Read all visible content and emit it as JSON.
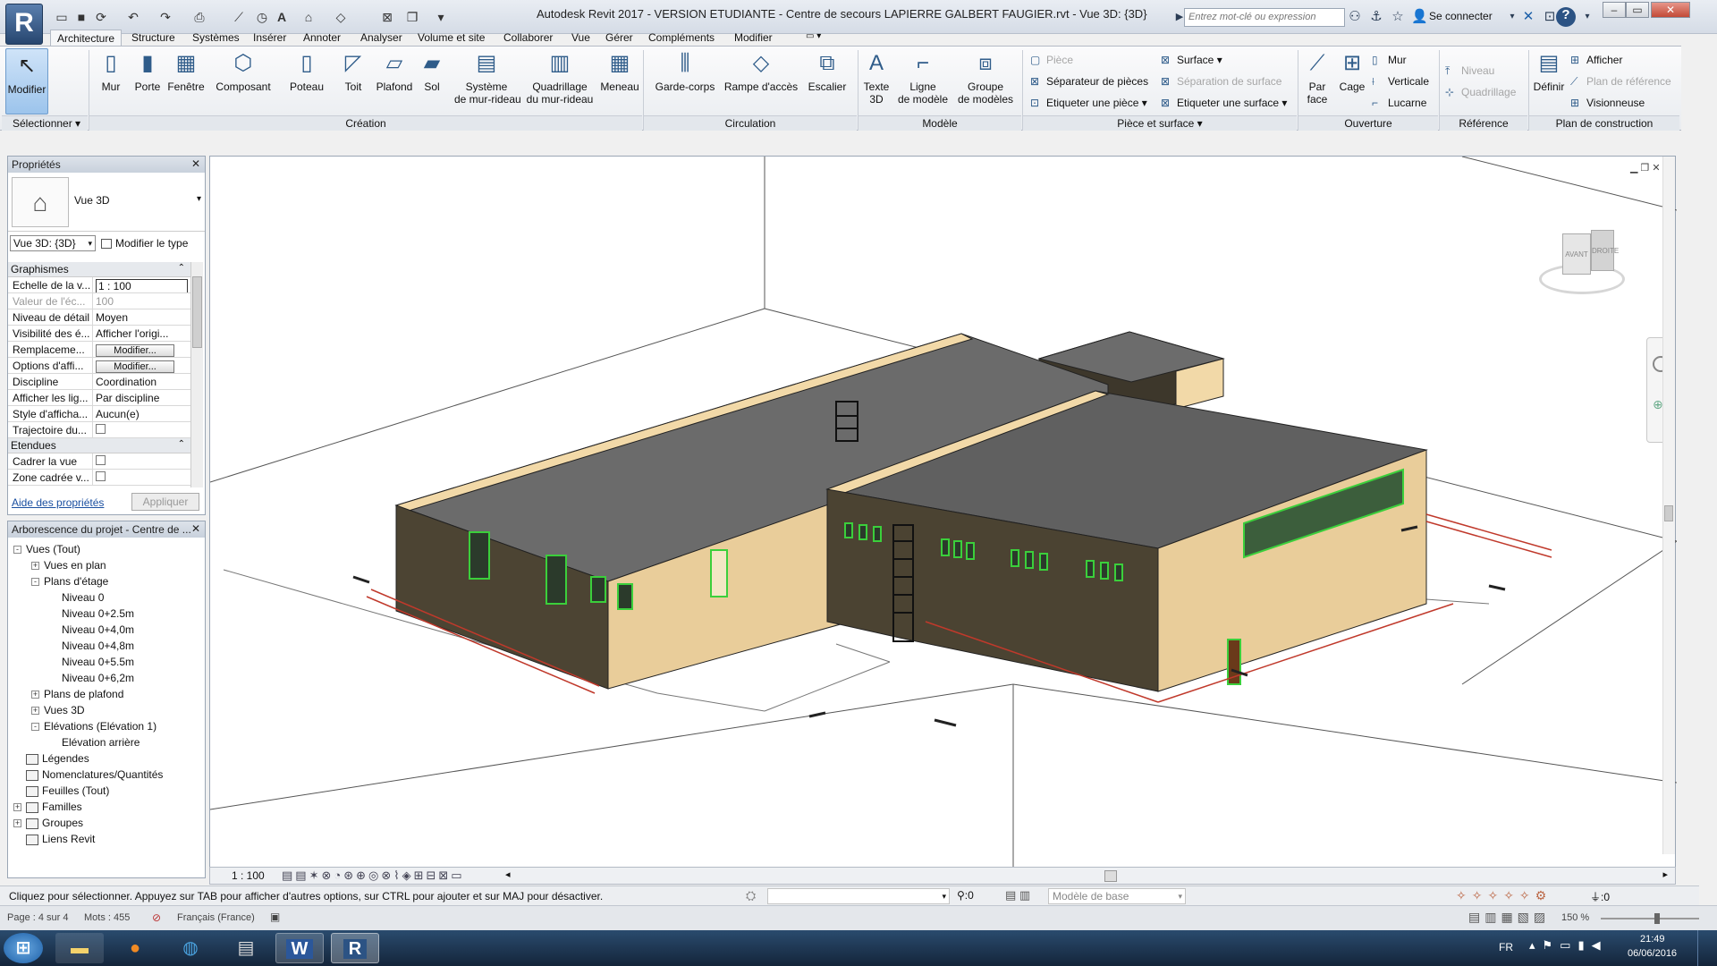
{
  "app": {
    "title": "Autodesk Revit 2017 - VERSION ETUDIANTE -",
    "file_title": "Centre de secours LAPIERRE GALBERT FAUGIER.rvt - Vue 3D: {3D}",
    "search_placeholder": "Entrez mot-clé ou expression",
    "sign_in": "Se connecter",
    "logo_letter": "R"
  },
  "tabs": [
    "Architecture",
    "Structure",
    "Systèmes",
    "Insérer",
    "Annoter",
    "Analyser",
    "Volume et site",
    "Collaborer",
    "Vue",
    "Gérer",
    "Compléments",
    "Modifier"
  ],
  "ribbon": {
    "select": {
      "modify": "Modifier",
      "label": "Sélectionner"
    },
    "creation": {
      "label": "Création",
      "buttons": [
        "Mur",
        "Porte",
        "Fenêtre",
        "Composant",
        "Poteau",
        "Toit",
        "Plafond",
        "Sol",
        "Système\nde mur-rideau",
        "Quadrillage\ndu mur-rideau",
        "Meneau"
      ]
    },
    "circulation": {
      "label": "Circulation",
      "buttons": [
        "Garde-corps",
        "Rampe d'accès",
        "Escalier"
      ]
    },
    "modele": {
      "label": "Modèle",
      "buttons": [
        "Texte\n3D",
        "Ligne\nde modèle",
        "Groupe\nde modèles"
      ]
    },
    "piece": {
      "label": "Pièce et surface",
      "items": [
        "Pièce",
        "Séparateur de pièces",
        "Etiqueter une pièce",
        "Surface",
        "Séparation de surface",
        "Etiqueter une surface"
      ]
    },
    "ouverture": {
      "label": "Ouverture",
      "par_face": "Par\nface",
      "cage": "Cage",
      "items": [
        "Mur",
        "Verticale",
        "Lucarne"
      ]
    },
    "reference": {
      "label": "Référence",
      "items": [
        "Niveau",
        "Quadrillage"
      ]
    },
    "plan": {
      "label": "Plan de construction",
      "definir": "Définir",
      "items": [
        "Afficher",
        "Plan de référence",
        "Visionneuse"
      ]
    }
  },
  "properties": {
    "title": "Propriétés",
    "type_name": "Vue 3D",
    "view_selector": "Vue 3D: {3D}",
    "edit_type": "Modifier le type",
    "groups": [
      {
        "name": "Graphismes",
        "rows": [
          {
            "k": "Echelle de la v...",
            "v": "1 : 100"
          },
          {
            "k": "Valeur de l'éc...",
            "v": "100"
          },
          {
            "k": "Niveau de détail",
            "v": "Moyen"
          },
          {
            "k": "Visibilité des é...",
            "v": "Afficher l'origi..."
          },
          {
            "k": "Remplaceme...",
            "v": "Modifier..."
          },
          {
            "k": "Options d'affi...",
            "v": "Modifier..."
          },
          {
            "k": "Discipline",
            "v": "Coordination"
          },
          {
            "k": "Afficher les lig...",
            "v": "Par discipline"
          },
          {
            "k": "Style d'afficha...",
            "v": "Aucun(e)"
          },
          {
            "k": "Trajectoire du...",
            "v": ""
          }
        ]
      },
      {
        "name": "Etendues",
        "rows": [
          {
            "k": "Cadrer la vue",
            "v": ""
          },
          {
            "k": "Zone cadrée v...",
            "v": ""
          }
        ]
      }
    ],
    "help": "Aide des propriétés",
    "apply": "Appliquer"
  },
  "browser": {
    "title": "Arborescence du projet - Centre de ...",
    "items": [
      {
        "label": "Vues (Tout)",
        "indent": 0,
        "exp": "-"
      },
      {
        "label": "Vues en plan",
        "indent": 1,
        "exp": "+"
      },
      {
        "label": "Plans d'étage",
        "indent": 1,
        "exp": "-"
      },
      {
        "label": "Niveau 0",
        "indent": 2,
        "exp": ""
      },
      {
        "label": "Niveau 0+2.5m",
        "indent": 2,
        "exp": ""
      },
      {
        "label": "Niveau 0+4,0m",
        "indent": 2,
        "exp": ""
      },
      {
        "label": "Niveau 0+4,8m",
        "indent": 2,
        "exp": ""
      },
      {
        "label": "Niveau 0+5.5m",
        "indent": 2,
        "exp": ""
      },
      {
        "label": "Niveau 0+6,2m",
        "indent": 2,
        "exp": ""
      },
      {
        "label": "Plans de plafond",
        "indent": 1,
        "exp": "+"
      },
      {
        "label": "Vues 3D",
        "indent": 1,
        "exp": "+"
      },
      {
        "label": "Elévations (Elévation 1)",
        "indent": 1,
        "exp": "-"
      },
      {
        "label": "Elévation arrière",
        "indent": 2,
        "exp": ""
      },
      {
        "label": "Légendes",
        "indent": 0,
        "exp": "",
        "icon": true
      },
      {
        "label": "Nomenclatures/Quantités",
        "indent": 0,
        "exp": "",
        "icon": true
      },
      {
        "label": "Feuilles (Tout)",
        "indent": 0,
        "exp": "",
        "icon": true
      },
      {
        "label": "Familles",
        "indent": 0,
        "exp": "+",
        "icon": true
      },
      {
        "label": "Groupes",
        "indent": 0,
        "exp": "+",
        "icon": true
      },
      {
        "label": "Liens Revit",
        "indent": 0,
        "exp": "",
        "icon": true
      }
    ]
  },
  "viewcube": {
    "front": "AVANT",
    "right": "DROITE"
  },
  "view_bar": {
    "scale": "1 : 100"
  },
  "status": {
    "message": "Cliquez pour sélectionner. Appuyez sur TAB pour afficher d'autres options, sur CTRL pour ajouter et sur MAJ pour désactiver.",
    "workset_value": ":0",
    "model": "Modèle de base",
    "filter_count": ":0"
  },
  "word_status": {
    "page": "Page : 4 sur 4",
    "words": "Mots : 455",
    "lang": "Français (France)",
    "zoom": "150 %"
  },
  "taskbar": {
    "lang": "FR",
    "time": "21:49",
    "date": "06/06/2016"
  }
}
